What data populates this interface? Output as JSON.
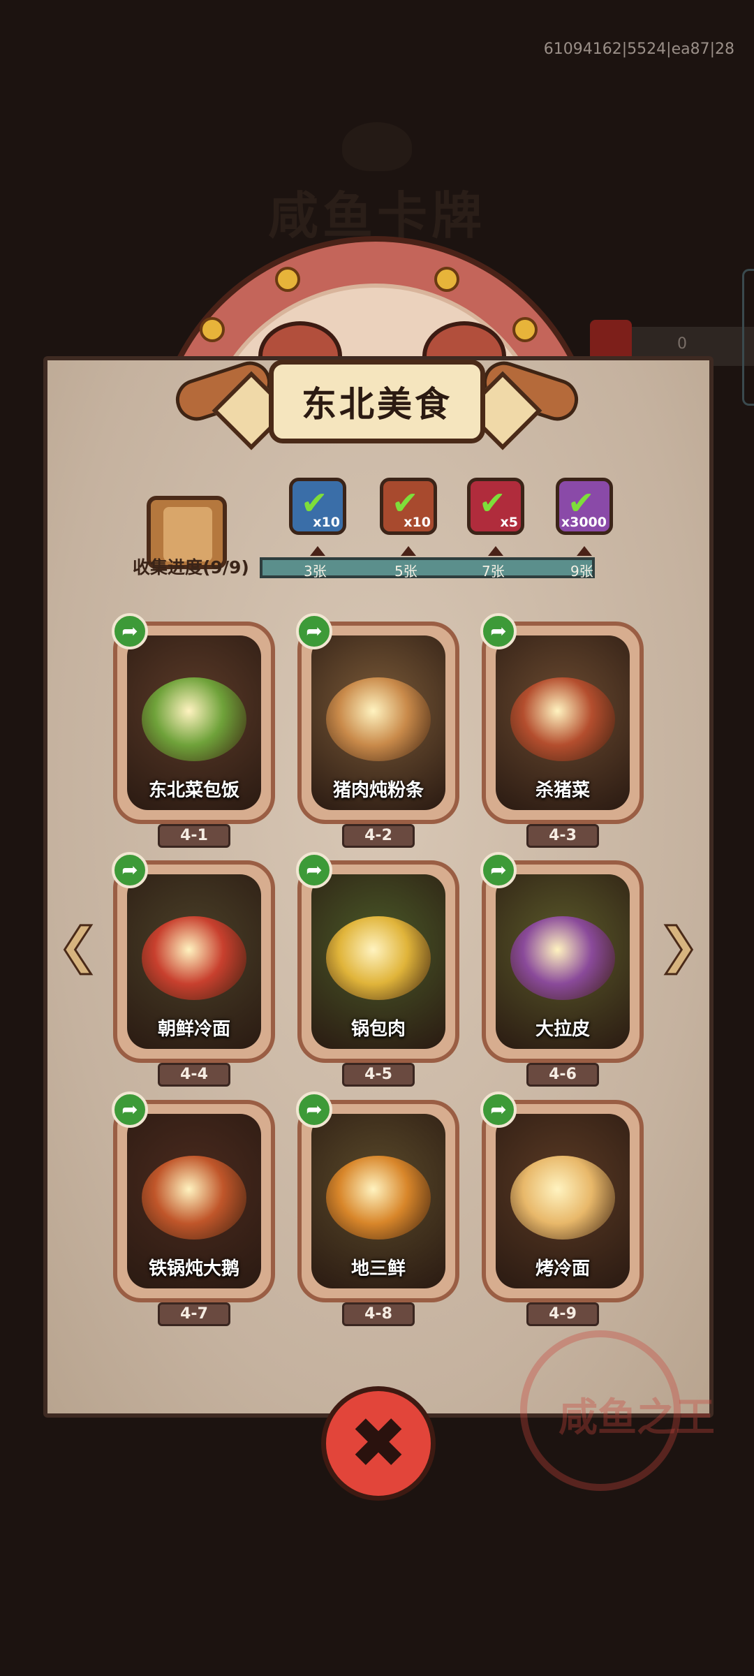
{
  "background": {
    "title": "咸鱼卡牌",
    "debug_id": "61094162|5524|ea87|28",
    "side_count": "0"
  },
  "panel": {
    "title": "东北美食",
    "stamp_text": "咸鱼之王"
  },
  "collection": {
    "label": "收集进度(9/9)",
    "current": 9,
    "total": 9,
    "rewards": [
      {
        "icon": "treasure-chest-icon",
        "qty": "x10",
        "threshold": "3张",
        "claimed": true,
        "color": "#3a6ea8"
      },
      {
        "icon": "golden-key-icon",
        "qty": "x10",
        "threshold": "5张",
        "claimed": true,
        "color": "#a84a2e"
      },
      {
        "icon": "purple-orb-icon",
        "qty": "x5",
        "threshold": "7张",
        "claimed": true,
        "color": "#b02c3c"
      },
      {
        "icon": "silver-ingot-icon",
        "qty": "x3000",
        "threshold": "9张",
        "claimed": true,
        "color": "#8a4aa8"
      }
    ]
  },
  "cards": [
    {
      "name": "东北菜包饭",
      "number": "4-1",
      "dish_color": "#6fa23a",
      "bg_color": "#5a3a28"
    },
    {
      "name": "猪肉炖粉条",
      "number": "4-2",
      "dish_color": "#c98a4a",
      "bg_color": "#7a5a38"
    },
    {
      "name": "杀猪菜",
      "number": "4-3",
      "dish_color": "#b44e2e",
      "bg_color": "#6a4a30"
    },
    {
      "name": "朝鲜冷面",
      "number": "4-4",
      "dish_color": "#c8402e",
      "bg_color": "#4a4028"
    },
    {
      "name": "锅包肉",
      "number": "4-5",
      "dish_color": "#e0b43a",
      "bg_color": "#4a5a28"
    },
    {
      "name": "大拉皮",
      "number": "4-6",
      "dish_color": "#8a4a9a",
      "bg_color": "#5a5a2a"
    },
    {
      "name": "铁锅炖大鹅",
      "number": "4-7",
      "dish_color": "#c0562a",
      "bg_color": "#4a2a1e"
    },
    {
      "name": "地三鲜",
      "number": "4-8",
      "dish_color": "#d8862a",
      "bg_color": "#5a4a2a"
    },
    {
      "name": "烤冷面",
      "number": "4-9",
      "dish_color": "#e8b86a",
      "bg_color": "#5a3a24"
    }
  ],
  "icons": {
    "share": "share-arrow-icon",
    "prev": "arrow-left-icon",
    "next": "arrow-right-icon",
    "close": "close-icon"
  },
  "glyphs": {
    "share": "➦",
    "prev": "❮",
    "next": "❯",
    "close": "✖",
    "check": "✔"
  }
}
